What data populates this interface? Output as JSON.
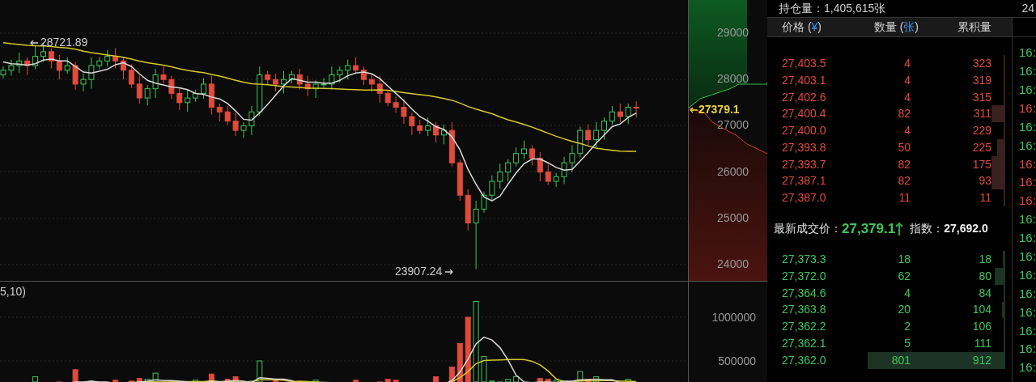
{
  "chart": {
    "high_label": "28721.89",
    "low_label": "23907.24",
    "last_price": "27379.1",
    "price_ticks": [
      "29000",
      "28000",
      "27000",
      "26000",
      "25000",
      "24000"
    ],
    "volume_label": "5,10)",
    "volume_ticks": [
      "1000000",
      "500000"
    ]
  },
  "header": {
    "position": "持仓量：1,405,615张",
    "cut_value": "24"
  },
  "order_book": {
    "columns": [
      {
        "prefix": "价格 (",
        "unit": "¥",
        "suffix": ")"
      },
      {
        "prefix": "数量 (",
        "unit": "张",
        "suffix": ")"
      },
      {
        "prefix": "累积量"
      }
    ],
    "asks": [
      {
        "price": "27,403.5",
        "amount": "4",
        "total": "323"
      },
      {
        "price": "27,403.1",
        "amount": "4",
        "total": "319"
      },
      {
        "price": "27,402.6",
        "amount": "4",
        "total": "315"
      },
      {
        "price": "27,400.4",
        "amount": "82",
        "total": "311"
      },
      {
        "price": "27,400.0",
        "amount": "4",
        "total": "229"
      },
      {
        "price": "27,393.8",
        "amount": "50",
        "total": "225"
      },
      {
        "price": "27,393.7",
        "amount": "82",
        "total": "175"
      },
      {
        "price": "27,387.1",
        "amount": "82",
        "total": "93"
      },
      {
        "price": "27,387.0",
        "amount": "11",
        "total": "11"
      }
    ],
    "last": {
      "label": "最新成交价：",
      "price": "27,379.1",
      "index_label": "指数：",
      "index": "27,692.0"
    },
    "bids": [
      {
        "price": "27,373.3",
        "amount": "18",
        "total": "18"
      },
      {
        "price": "27,372.0",
        "amount": "62",
        "total": "80"
      },
      {
        "price": "27,364.6",
        "amount": "4",
        "total": "84"
      },
      {
        "price": "27,363.8",
        "amount": "20",
        "total": "104"
      },
      {
        "price": "27,362.2",
        "amount": "2",
        "total": "106"
      },
      {
        "price": "27,362.1",
        "amount": "5",
        "total": "111"
      },
      {
        "price": "27,362.0",
        "amount": "801",
        "total": "912"
      }
    ]
  },
  "trades": [
    {
      "time": "16:",
      "color": "#3ec75c"
    },
    {
      "time": "16:",
      "color": "#3ec75c"
    },
    {
      "time": "16:",
      "color": "#3ec75c"
    },
    {
      "time": "16:",
      "color": "#e04b3b"
    },
    {
      "time": "16:",
      "color": "#3ec75c"
    },
    {
      "time": "16:",
      "color": "#3ec75c"
    },
    {
      "time": "16:",
      "color": "#e04b3b"
    },
    {
      "time": "16:",
      "color": "#e04b3b"
    },
    {
      "time": "16:",
      "color": "#e04b3b"
    },
    {
      "time": "16:",
      "color": "#3ec75c"
    },
    {
      "time": "16:",
      "color": "#3ec75c"
    },
    {
      "time": "16:",
      "color": "#3ec75c"
    },
    {
      "time": "16:",
      "color": "#3ec75c"
    },
    {
      "time": "16:",
      "color": "#3ec75c"
    },
    {
      "time": "16:",
      "color": "#3ec75c"
    },
    {
      "time": "16:",
      "color": "#3ec75c"
    },
    {
      "time": "16:",
      "color": "#3ec75c"
    },
    {
      "time": "16:",
      "color": "#3ec75c"
    }
  ]
}
